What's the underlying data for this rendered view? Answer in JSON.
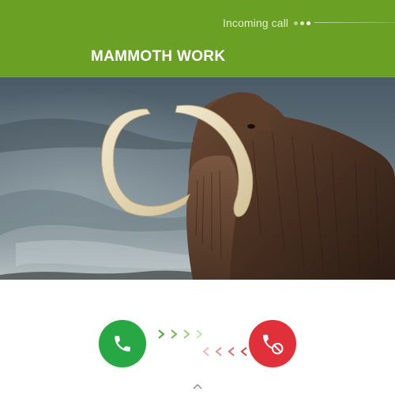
{
  "header": {
    "status_label": "Incoming call",
    "caller_name": "MAMMOTH WORK",
    "background_color": "#6aa125"
  },
  "photo": {
    "description_icon": "mammoth-photo"
  },
  "controls": {
    "answer_icon": "phone-icon",
    "answer_color": "#27a844",
    "decline_icon": "phone-decline-icon",
    "decline_color": "#e0313b",
    "swipe_hint_icon": "chevron-up-icon"
  }
}
